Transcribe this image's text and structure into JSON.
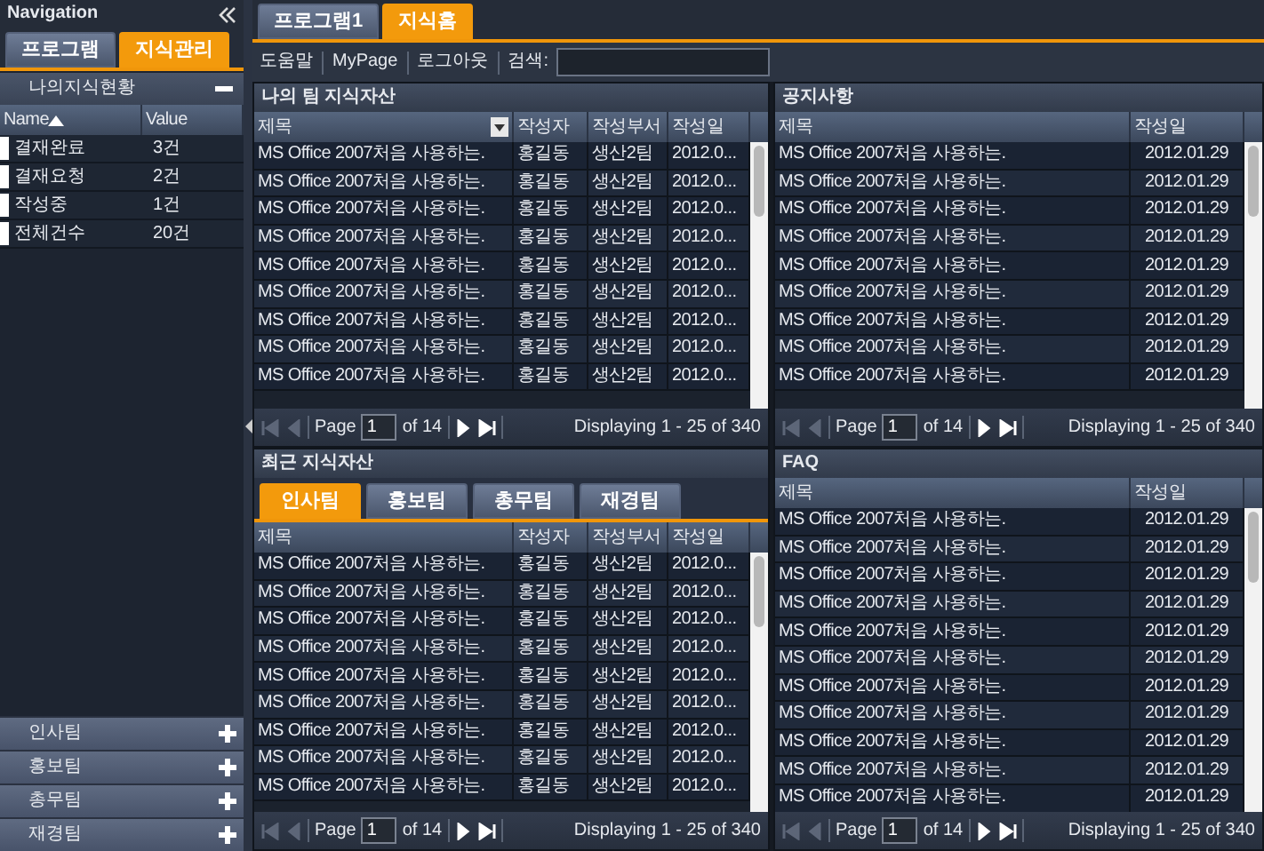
{
  "navigation": {
    "title": "Navigation",
    "tabs": [
      {
        "label": "프로그램",
        "selected": false
      },
      {
        "label": "지식관리",
        "selected": true
      }
    ],
    "section": {
      "title": "나의지식현황",
      "expanded": true
    },
    "columns": [
      {
        "label": "Name",
        "sorted": true
      },
      {
        "label": "Value",
        "sorted": false
      }
    ],
    "rows": [
      {
        "name": "결재완료",
        "value": "3건"
      },
      {
        "name": "결재요청",
        "value": "2건"
      },
      {
        "name": "작성중",
        "value": "1건"
      },
      {
        "name": "전체건수",
        "value": "20건"
      }
    ],
    "accordion": [
      {
        "label": "인사팀",
        "expanded": false
      },
      {
        "label": "홍보팀",
        "expanded": false
      },
      {
        "label": "총무팀",
        "expanded": false
      },
      {
        "label": "재경팀",
        "expanded": false
      }
    ]
  },
  "main_tabs": [
    {
      "label": "프로그램1",
      "selected": false
    },
    {
      "label": "지식홈",
      "selected": true
    }
  ],
  "toolbar": {
    "links": [
      "도움말",
      "MyPage",
      "로그아웃"
    ],
    "search_label": "검색:"
  },
  "panels": [
    {
      "title": "나의 팀 지식자산",
      "kind": "wide",
      "columns": [
        {
          "label": "제목",
          "menu": true
        },
        {
          "label": "작성자",
          "menu": false
        },
        {
          "label": "작성부서",
          "menu": false
        },
        {
          "label": "작성일",
          "menu": false
        }
      ],
      "rows": [
        [
          "MS Office 2007처음 사용하는.",
          "홍길동",
          "생산2팀",
          "2012.0..."
        ],
        [
          "MS Office 2007처음 사용하는.",
          "홍길동",
          "생산2팀",
          "2012.0..."
        ],
        [
          "MS Office 2007처음 사용하는.",
          "홍길동",
          "생산2팀",
          "2012.0..."
        ],
        [
          "MS Office 2007처음 사용하는.",
          "홍길동",
          "생산2팀",
          "2012.0..."
        ],
        [
          "MS Office 2007처음 사용하는.",
          "홍길동",
          "생산2팀",
          "2012.0..."
        ],
        [
          "MS Office 2007처음 사용하는.",
          "홍길동",
          "생산2팀",
          "2012.0..."
        ],
        [
          "MS Office 2007처음 사용하는.",
          "홍길동",
          "생산2팀",
          "2012.0..."
        ],
        [
          "MS Office 2007처음 사용하는.",
          "홍길동",
          "생산2팀",
          "2012.0..."
        ],
        [
          "MS Office 2007처음 사용하는.",
          "홍길동",
          "생산2팀",
          "2012.0..."
        ]
      ],
      "pager": {
        "page_label": "Page",
        "page": "1",
        "of": "of 14",
        "display": "Displaying 1 - 25 of 340",
        "buttons": [
          {
            "kind": "first",
            "disabled": true
          },
          {
            "kind": "prev",
            "disabled": true
          },
          {
            "kind": "next",
            "disabled": false
          },
          {
            "kind": "last",
            "disabled": false
          }
        ]
      }
    },
    {
      "title": "공지사항",
      "kind": "narrow",
      "columns": [
        {
          "label": "제목",
          "menu": false
        },
        {
          "label": "작성일",
          "menu": false
        }
      ],
      "rows": [
        [
          "MS Office 2007처음 사용하는.",
          "2012.01.29"
        ],
        [
          "MS Office 2007처음 사용하는.",
          "2012.01.29"
        ],
        [
          "MS Office 2007처음 사용하는.",
          "2012.01.29"
        ],
        [
          "MS Office 2007처음 사용하는.",
          "2012.01.29"
        ],
        [
          "MS Office 2007처음 사용하는.",
          "2012.01.29"
        ],
        [
          "MS Office 2007처음 사용하는.",
          "2012.01.29"
        ],
        [
          "MS Office 2007처음 사용하는.",
          "2012.01.29"
        ],
        [
          "MS Office 2007처음 사용하는.",
          "2012.01.29"
        ],
        [
          "MS Office 2007처음 사용하는.",
          "2012.01.29"
        ]
      ],
      "pager": {
        "page_label": "Page",
        "page": "1",
        "of": "of 14",
        "display": "Displaying 1 - 25 of 340",
        "buttons": [
          {
            "kind": "first",
            "disabled": true
          },
          {
            "kind": "prev",
            "disabled": true
          },
          {
            "kind": "next",
            "disabled": false
          },
          {
            "kind": "last",
            "disabled": false
          }
        ]
      }
    },
    {
      "title": "최근 지식자산",
      "kind": "wide",
      "tabs": [
        {
          "label": "인사팀",
          "selected": true
        },
        {
          "label": "홍보팀",
          "selected": false
        },
        {
          "label": "총무팀",
          "selected": false
        },
        {
          "label": "재경팀",
          "selected": false
        }
      ],
      "columns": [
        {
          "label": "제목",
          "menu": false
        },
        {
          "label": "작성자",
          "menu": false
        },
        {
          "label": "작성부서",
          "menu": false
        },
        {
          "label": "작성일",
          "menu": false
        }
      ],
      "rows": [
        [
          "MS Office 2007처음 사용하는.",
          "홍길동",
          "생산2팀",
          "2012.0..."
        ],
        [
          "MS Office 2007처음 사용하는.",
          "홍길동",
          "생산2팀",
          "2012.0..."
        ],
        [
          "MS Office 2007처음 사용하는.",
          "홍길동",
          "생산2팀",
          "2012.0..."
        ],
        [
          "MS Office 2007처음 사용하는.",
          "홍길동",
          "생산2팀",
          "2012.0..."
        ],
        [
          "MS Office 2007처음 사용하는.",
          "홍길동",
          "생산2팀",
          "2012.0..."
        ],
        [
          "MS Office 2007처음 사용하는.",
          "홍길동",
          "생산2팀",
          "2012.0..."
        ],
        [
          "MS Office 2007처음 사용하는.",
          "홍길동",
          "생산2팀",
          "2012.0..."
        ],
        [
          "MS Office 2007처음 사용하는.",
          "홍길동",
          "생산2팀",
          "2012.0..."
        ],
        [
          "MS Office 2007처음 사용하는.",
          "홍길동",
          "생산2팀",
          "2012.0..."
        ]
      ],
      "pager": {
        "page_label": "Page",
        "page": "1",
        "of": "of 14",
        "display": "Displaying 1 - 25 of 340",
        "buttons": [
          {
            "kind": "first",
            "disabled": true
          },
          {
            "kind": "prev",
            "disabled": true
          },
          {
            "kind": "next",
            "disabled": false
          },
          {
            "kind": "last",
            "disabled": false
          }
        ]
      }
    },
    {
      "title": "FAQ",
      "kind": "narrow",
      "columns": [
        {
          "label": "제목",
          "menu": false
        },
        {
          "label": "작성일",
          "menu": false
        }
      ],
      "rows": [
        [
          "MS Office 2007처음 사용하는.",
          "2012.01.29"
        ],
        [
          "MS Office 2007처음 사용하는.",
          "2012.01.29"
        ],
        [
          "MS Office 2007처음 사용하는.",
          "2012.01.29"
        ],
        [
          "MS Office 2007처음 사용하는.",
          "2012.01.29"
        ],
        [
          "MS Office 2007처음 사용하는.",
          "2012.01.29"
        ],
        [
          "MS Office 2007처음 사용하는.",
          "2012.01.29"
        ],
        [
          "MS Office 2007처음 사용하는.",
          "2012.01.29"
        ],
        [
          "MS Office 2007처음 사용하는.",
          "2012.01.29"
        ],
        [
          "MS Office 2007처음 사용하는.",
          "2012.01.29"
        ],
        [
          "MS Office 2007처음 사용하는.",
          "2012.01.29"
        ],
        [
          "MS Office 2007처음 사용하는.",
          "2012.01.29"
        ]
      ],
      "pager": {
        "page_label": "Page",
        "page": "1",
        "of": "of 14",
        "display": "Displaying 1 - 25 of 340",
        "buttons": [
          {
            "kind": "first",
            "disabled": true
          },
          {
            "kind": "prev",
            "disabled": true
          },
          {
            "kind": "next",
            "disabled": false
          },
          {
            "kind": "last",
            "disabled": false
          }
        ]
      }
    }
  ]
}
